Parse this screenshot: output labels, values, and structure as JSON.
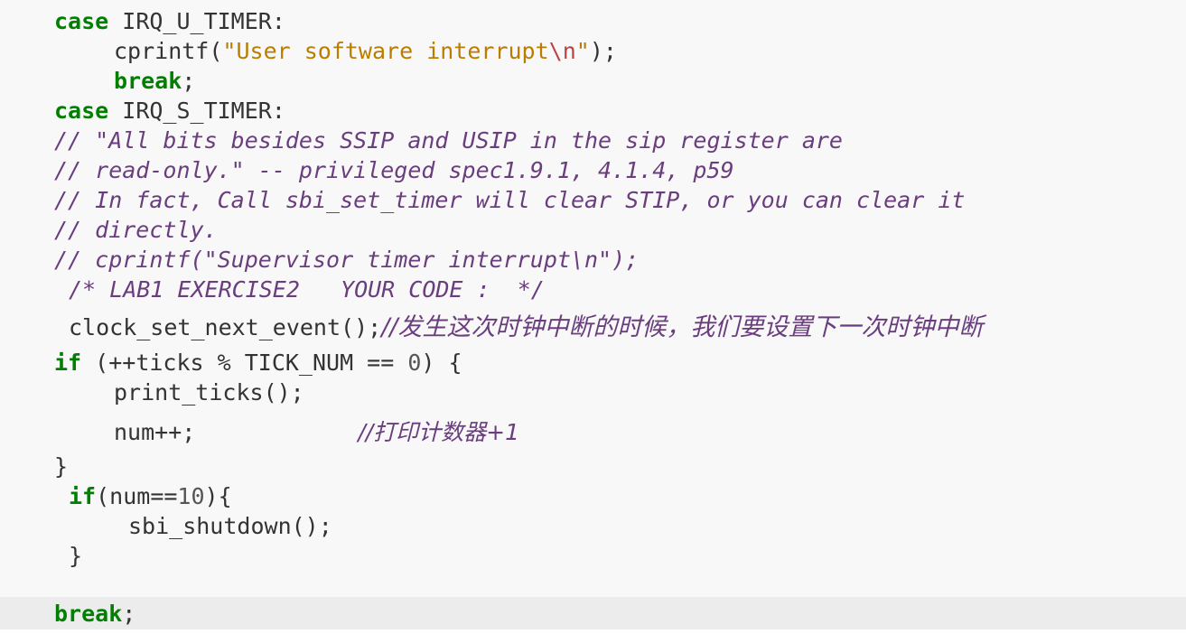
{
  "code": {
    "line1": {
      "kw": "case",
      "rest": " IRQ_U_TIMER:"
    },
    "line2": {
      "pre": "cprintf(",
      "str_open": "\"User software interrupt",
      "esc": "\\n",
      "str_close": "\"",
      "post": ");"
    },
    "line3": {
      "kw": "break",
      "post": ";"
    },
    "line4": {
      "kw": "case",
      "rest": " IRQ_S_TIMER:"
    },
    "line5": "// \"All bits besides SSIP and USIP in the sip register are",
    "line6": "// read-only.\" -- privileged spec1.9.1, 4.1.4, p59",
    "line7": "// In fact, Call sbi_set_timer will clear STIP, or you can clear it",
    "line8": "// directly.",
    "line9": "// cprintf(\"Supervisor timer interrupt\\n\");",
    "line10": "/* LAB1 EXERCISE2   YOUR CODE :  */",
    "line11": {
      "code": "clock_set_next_event();",
      "comment": "//发生这次时钟中断的时候，我们要设置下一次时钟中断"
    },
    "line12": {
      "kw": "if",
      "pre": " (++ticks % TICK_NUM == ",
      "num": "0",
      "post": ") {"
    },
    "line13": "print_ticks();",
    "line14": {
      "code": "num++;",
      "comment": "//打印计数器+1"
    },
    "line15": "}",
    "line16": {
      "kw": "if",
      "pre": "(num==",
      "num": "10",
      "post": "){"
    },
    "line17": "sbi_shutdown();",
    "line18": "}",
    "line19": {
      "kw": "break",
      "post": ";"
    }
  },
  "colors": {
    "keyword": "#008000",
    "string": "#ba7d00",
    "comment": "#6a3d7e",
    "background": "#f8f8f8",
    "highlight": "#ececec"
  }
}
